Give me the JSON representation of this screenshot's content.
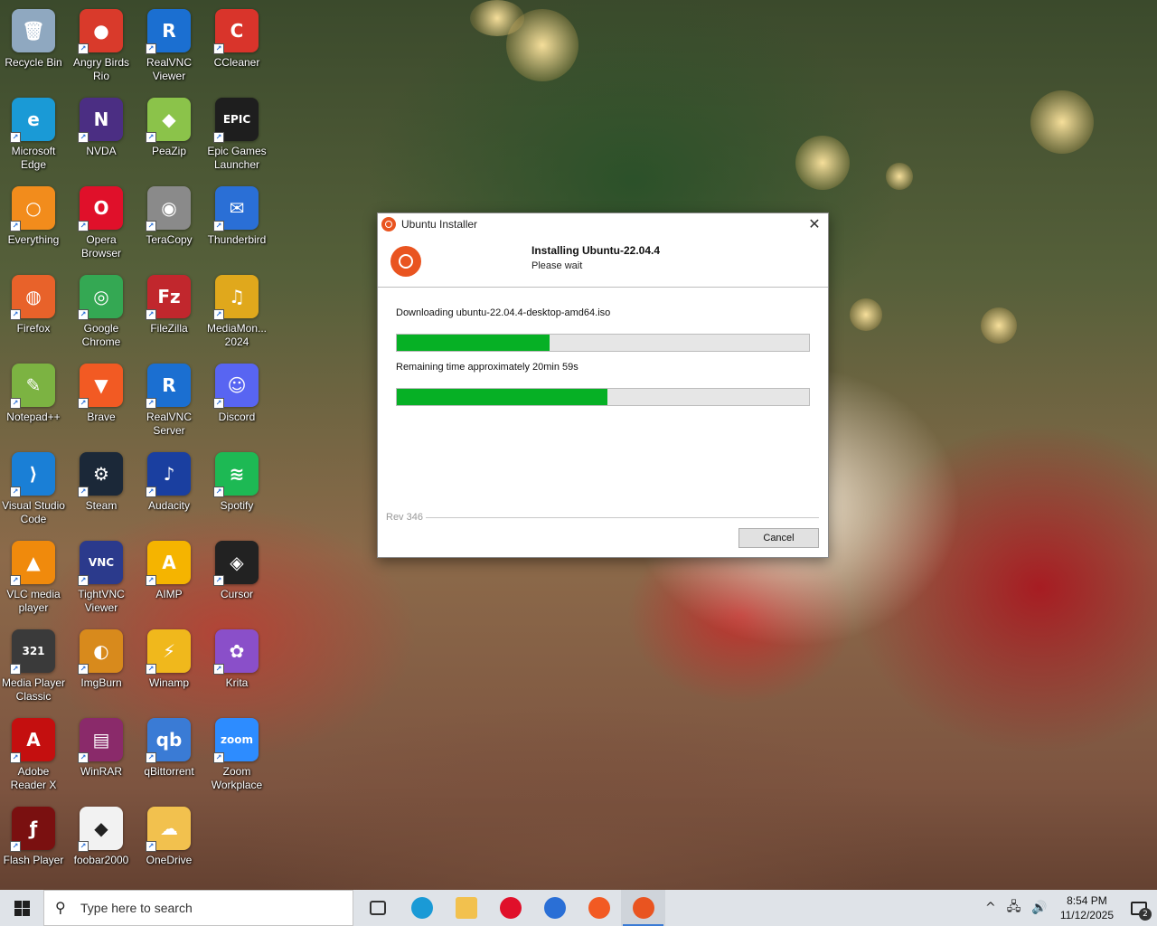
{
  "desktop": {
    "icons": [
      {
        "label": "Recycle Bin",
        "color": "#8fa8c0",
        "glyph": "🗑"
      },
      {
        "label": "Angry Birds Rio",
        "color": "#d93a2b",
        "glyph": "●"
      },
      {
        "label": "RealVNC Viewer",
        "color": "#1b6fd1",
        "glyph": "R"
      },
      {
        "label": "CCleaner",
        "color": "#d9342b",
        "glyph": "C"
      },
      {
        "label": "Microsoft Edge",
        "color": "#1a9ad6",
        "glyph": "e"
      },
      {
        "label": "NVDA",
        "color": "#4b2e83",
        "glyph": "N"
      },
      {
        "label": "PeaZip",
        "color": "#8bc34a",
        "glyph": "◆"
      },
      {
        "label": "Epic Games Launcher",
        "color": "#1e1e1e",
        "glyph": "EPIC"
      },
      {
        "label": "Everything",
        "color": "#f28c1c",
        "glyph": "○"
      },
      {
        "label": "Opera Browser",
        "color": "#e0102a",
        "glyph": "O"
      },
      {
        "label": "TeraCopy",
        "color": "#8a8a8a",
        "glyph": "◉"
      },
      {
        "label": "Thunderbird",
        "color": "#2a6fd6",
        "glyph": "✉"
      },
      {
        "label": "Firefox",
        "color": "#e8622a",
        "glyph": "◍"
      },
      {
        "label": "Google Chrome",
        "color": "#34a853",
        "glyph": "◎"
      },
      {
        "label": "FileZilla",
        "color": "#c1272d",
        "glyph": "Fz"
      },
      {
        "label": "MediaMon... 2024",
        "color": "#e0a81c",
        "glyph": "♫"
      },
      {
        "label": "Notepad++",
        "color": "#7cb342",
        "glyph": "✎"
      },
      {
        "label": "Brave",
        "color": "#f25a23",
        "glyph": "▼"
      },
      {
        "label": "RealVNC Server",
        "color": "#1b6fd1",
        "glyph": "R"
      },
      {
        "label": "Discord",
        "color": "#5865f2",
        "glyph": "☺"
      },
      {
        "label": "Visual Studio Code",
        "color": "#1a7fd6",
        "glyph": "⟩"
      },
      {
        "label": "Steam",
        "color": "#1b2838",
        "glyph": "⚙"
      },
      {
        "label": "Audacity",
        "color": "#1a3fa0",
        "glyph": "♪"
      },
      {
        "label": "Spotify",
        "color": "#1db954",
        "glyph": "≋"
      },
      {
        "label": "VLC media player",
        "color": "#f08a0c",
        "glyph": "▲"
      },
      {
        "label": "TightVNC Viewer",
        "color": "#2b3a8c",
        "glyph": "VNC"
      },
      {
        "label": "AIMP",
        "color": "#f5b400",
        "glyph": "A"
      },
      {
        "label": "Cursor",
        "color": "#222222",
        "glyph": "◈"
      },
      {
        "label": "Media Player Classic",
        "color": "#3a3a3a",
        "glyph": "321"
      },
      {
        "label": "ImgBurn",
        "color": "#d88a1c",
        "glyph": "◐"
      },
      {
        "label": "Winamp",
        "color": "#f0b81c",
        "glyph": "⚡"
      },
      {
        "label": "Krita",
        "color": "#8a4fc9",
        "glyph": "✿"
      },
      {
        "label": "Adobe Reader X",
        "color": "#c40f0f",
        "glyph": "A"
      },
      {
        "label": "WinRAR",
        "color": "#8a2a6a",
        "glyph": "▤"
      },
      {
        "label": "qBittorrent",
        "color": "#3a7bd5",
        "glyph": "qb"
      },
      {
        "label": "Zoom Workplace",
        "color": "#2d8cff",
        "glyph": "zoom"
      },
      {
        "label": "Flash Player",
        "color": "#7a1010",
        "glyph": "ƒ"
      },
      {
        "label": "foobar2000",
        "color": "#f2f2f2",
        "glyph": "◆"
      },
      {
        "label": "OneDrive",
        "color": "#f2c14e",
        "glyph": "☁"
      }
    ]
  },
  "installer": {
    "window_title": "Ubuntu Installer",
    "close_glyph": "✕",
    "heading": "Installing Ubuntu-22.04.4",
    "subheading": "Please wait",
    "download_label": "Downloading ubuntu-22.04.4-desktop-amd64.iso",
    "download_progress": 0.37,
    "remaining_label": "Remaining time approximately 20min 59s",
    "overall_progress": 0.51,
    "revision": "Rev 346",
    "cancel_label": "Cancel",
    "accent_color": "#e95420",
    "progress_color": "#06b025"
  },
  "taskbar": {
    "search_placeholder": "Type here to search",
    "search_glyph": "⚲",
    "apps": [
      {
        "name": "task-view",
        "color": "#333333"
      },
      {
        "name": "edge",
        "color": "#1a9ad6"
      },
      {
        "name": "file-explorer",
        "color": "#f2c14e"
      },
      {
        "name": "opera",
        "color": "#e0102a"
      },
      {
        "name": "thunderbird",
        "color": "#2a6fd6"
      },
      {
        "name": "brave",
        "color": "#f25a23"
      },
      {
        "name": "ubuntu-installer",
        "color": "#e95420"
      }
    ],
    "tray_chevron": "^",
    "tray_network": "🖧",
    "tray_volume": "🔊",
    "time": "8:54 PM",
    "date": "11/12/2025",
    "notification_count": "2"
  }
}
